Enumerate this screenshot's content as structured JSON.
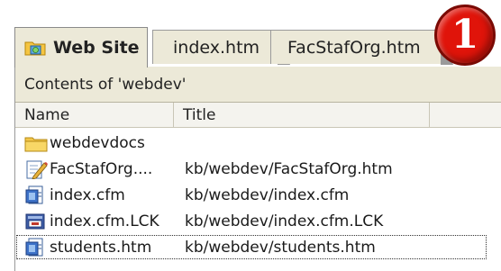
{
  "tabs": [
    {
      "label": "Web Site",
      "icon": "website-icon",
      "active": true
    },
    {
      "label": "index.htm",
      "active": false
    },
    {
      "label": "FacStafOrg.htm",
      "active": false
    }
  ],
  "badge": {
    "label": "1",
    "color": "#e0140a"
  },
  "panel": {
    "contents_label": "Contents of 'webdev'",
    "columns": [
      "Name",
      "Title"
    ],
    "rows": [
      {
        "name": "webdevdocs",
        "title": "",
        "icon": "folder-icon"
      },
      {
        "name": "FacStafOrg....",
        "title": "kb/webdev/FacStafOrg.htm",
        "icon": "html-edit-icon"
      },
      {
        "name": "index.cfm",
        "title": "kb/webdev/index.cfm",
        "icon": "cfm-file-icon"
      },
      {
        "name": "index.cfm.LCK",
        "title": "kb/webdev/index.cfm.LCK",
        "icon": "lock-file-icon"
      },
      {
        "name": "students.htm",
        "title": "kb/webdev/students.htm",
        "icon": "html-file-icon",
        "focused": true
      }
    ]
  }
}
